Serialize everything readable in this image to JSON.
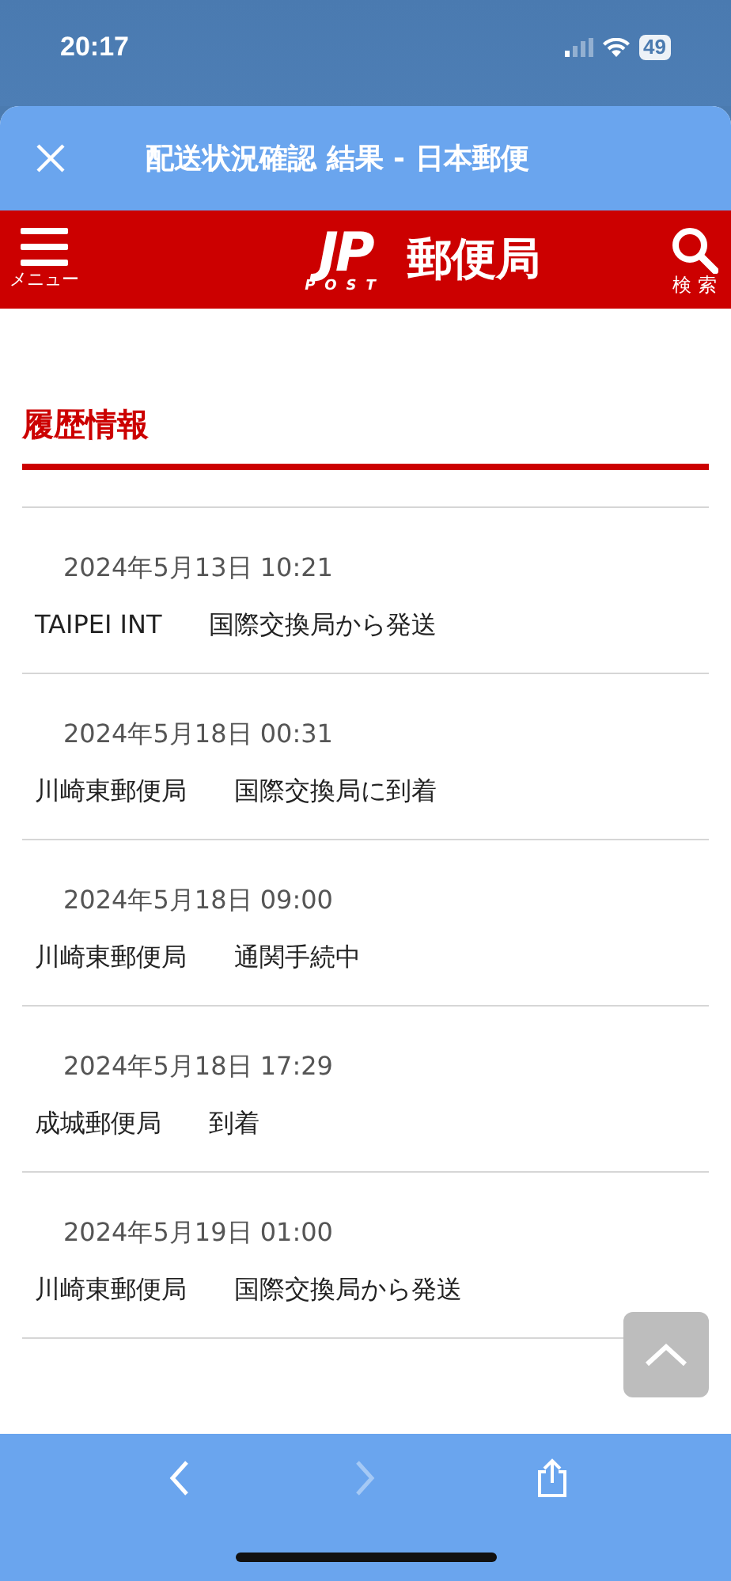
{
  "status_bar": {
    "time": "20:17",
    "battery": "49"
  },
  "browser": {
    "title": "配送状況確認 結果 - 日本郵便"
  },
  "header": {
    "menu_label": "メニュー",
    "logo_mark": "JP",
    "logo_sub": "POST",
    "logo_text": "郵便局",
    "search_label": "検 索"
  },
  "section_title": "履歴情報",
  "history": [
    {
      "datetime": "2024年5月13日 10:21",
      "office": "TAIPEI INT",
      "status": "国際交換局から発送"
    },
    {
      "datetime": "2024年5月18日 00:31",
      "office": "川崎東郵便局",
      "status": "国際交換局に到着"
    },
    {
      "datetime": "2024年5月18日 09:00",
      "office": "川崎東郵便局",
      "status": "通関手続中"
    },
    {
      "datetime": "2024年5月18日 17:29",
      "office": "成城郵便局",
      "status": "到着"
    },
    {
      "datetime": "2024年5月19日 01:00",
      "office": "川崎東郵便局",
      "status": "国際交換局から発送"
    }
  ],
  "toolbar": {
    "back": {
      "disabled": false
    },
    "forward": {
      "disabled": true
    }
  }
}
